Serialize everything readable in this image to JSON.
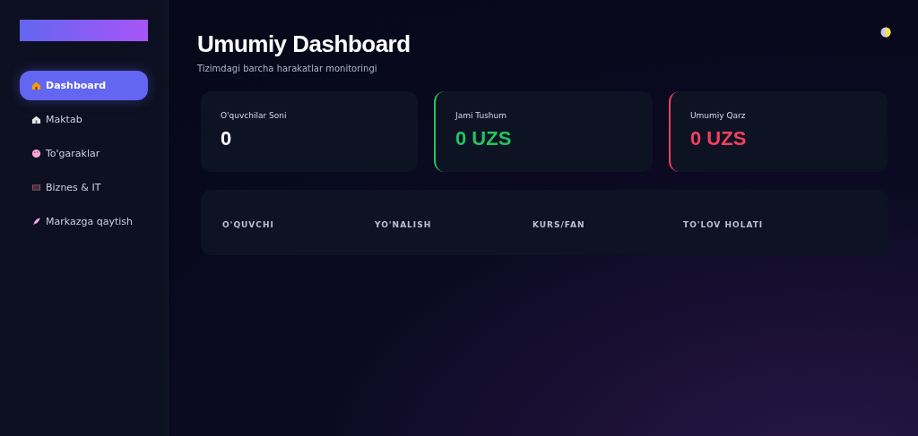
{
  "sidebar": {
    "items": [
      {
        "kind": "house",
        "label": "Dashboard",
        "selected": true
      },
      {
        "kind": "school",
        "label": "Maktab",
        "selected": false
      },
      {
        "kind": "palette",
        "label": "To'garaklar",
        "selected": false
      },
      {
        "kind": "laptop",
        "label": "Biznes & IT",
        "selected": false
      },
      {
        "kind": "rocket",
        "label": "Markazga qaytish",
        "selected": false
      }
    ]
  },
  "header": {
    "title": "Umumiy Dashboard",
    "subtitle": "Tizimdagi barcha harakatlar monitoringi"
  },
  "stats": [
    {
      "kind": "plain",
      "label": "O'quvchilar Soni",
      "value": "0",
      "color": "#ffffff"
    },
    {
      "kind": "accent",
      "label": "Jami Tushum",
      "value": "0 UZS",
      "color": "#22c55e"
    },
    {
      "kind": "accent",
      "label": "Umumiy Qarz",
      "value": "0 UZS",
      "color": "#f43f5e"
    }
  ],
  "table": {
    "columns": [
      "O'QUVCHI",
      "YO'NALISH",
      "KURS/FAN",
      "TO'LOV HOLATI"
    ]
  }
}
